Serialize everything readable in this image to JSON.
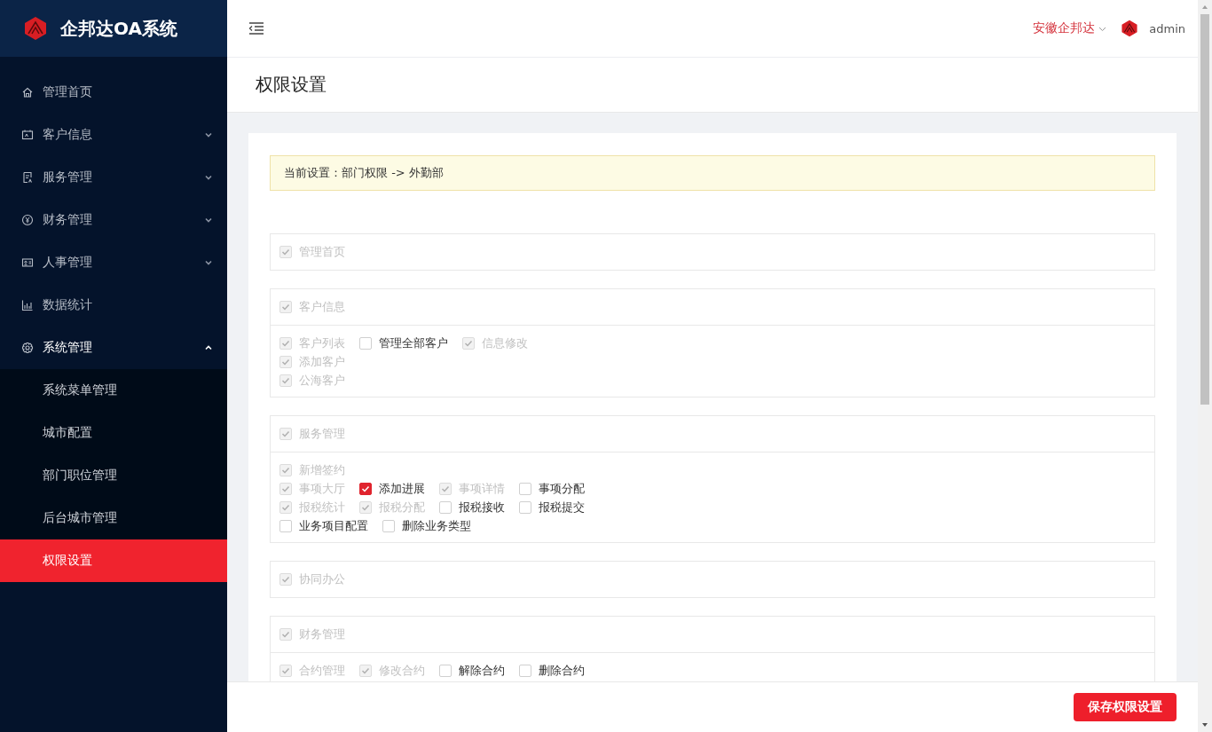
{
  "brand": {
    "title": "企邦达OA系统"
  },
  "sidebar": {
    "items": [
      {
        "kind": "home",
        "label": "管理首页",
        "expandable": false,
        "expanded": false,
        "selected": false
      },
      {
        "kind": "card",
        "label": "客户信息",
        "expandable": true,
        "expanded": false,
        "selected": false
      },
      {
        "kind": "doc",
        "label": "服务管理",
        "expandable": true,
        "expanded": false,
        "selected": false
      },
      {
        "kind": "yen",
        "label": "财务管理",
        "expandable": true,
        "expanded": false,
        "selected": false
      },
      {
        "kind": "id",
        "label": "人事管理",
        "expandable": true,
        "expanded": false,
        "selected": false
      },
      {
        "kind": "chart",
        "label": "数据统计",
        "expandable": false,
        "expanded": false,
        "selected": false
      },
      {
        "kind": "gear",
        "label": "系统管理",
        "expandable": true,
        "expanded": true,
        "selected": false,
        "children": [
          {
            "label": "系统菜单管理",
            "selected": false
          },
          {
            "label": "城市配置",
            "selected": false
          },
          {
            "label": "部门职位管理",
            "selected": false
          },
          {
            "label": "后台城市管理",
            "selected": false
          },
          {
            "label": "权限设置",
            "selected": true
          }
        ]
      }
    ]
  },
  "header": {
    "company": "安徽企邦达",
    "user": "admin"
  },
  "page_title": "权限设置",
  "notice": "当前设置：部门权限 -> 外勤部",
  "groups": [
    {
      "head": {
        "label": "管理首页",
        "checked": true,
        "disabled": true
      }
    },
    {
      "head": {
        "label": "客户信息",
        "checked": true,
        "disabled": true
      },
      "rows": [
        [
          {
            "label": "客户列表",
            "checked": true,
            "disabled": true
          },
          {
            "label": "管理全部客户",
            "checked": false,
            "disabled": false
          },
          {
            "label": "信息修改",
            "checked": true,
            "disabled": true
          }
        ],
        [
          {
            "label": "添加客户",
            "checked": true,
            "disabled": true
          }
        ],
        [
          {
            "label": "公海客户",
            "checked": true,
            "disabled": true
          }
        ]
      ]
    },
    {
      "head": {
        "label": "服务管理",
        "checked": true,
        "disabled": true
      },
      "rows": [
        [
          {
            "label": "新增签约",
            "checked": true,
            "disabled": true
          }
        ],
        [
          {
            "label": "事项大厅",
            "checked": true,
            "disabled": true
          },
          {
            "label": "添加进展",
            "checked": true,
            "disabled": false
          },
          {
            "label": "事项详情",
            "checked": true,
            "disabled": true
          },
          {
            "label": "事项分配",
            "checked": false,
            "disabled": false
          }
        ],
        [
          {
            "label": "报税统计",
            "checked": true,
            "disabled": true
          },
          {
            "label": "报税分配",
            "checked": true,
            "disabled": true
          },
          {
            "label": "报税接收",
            "checked": false,
            "disabled": false
          },
          {
            "label": "报税提交",
            "checked": false,
            "disabled": false
          }
        ],
        [
          {
            "label": "业务项目配置",
            "checked": false,
            "disabled": false
          },
          {
            "label": "删除业务类型",
            "checked": false,
            "disabled": false
          }
        ]
      ]
    },
    {
      "head": {
        "label": "协同办公",
        "checked": true,
        "disabled": true
      }
    },
    {
      "head": {
        "label": "财务管理",
        "checked": true,
        "disabled": true
      },
      "rows": [
        [
          {
            "label": "合约管理",
            "checked": true,
            "disabled": true
          },
          {
            "label": "修改合约",
            "checked": true,
            "disabled": true
          },
          {
            "label": "解除合约",
            "checked": false,
            "disabled": false
          },
          {
            "label": "删除合约",
            "checked": false,
            "disabled": false
          }
        ]
      ]
    }
  ],
  "save_button": "保存权限设置"
}
